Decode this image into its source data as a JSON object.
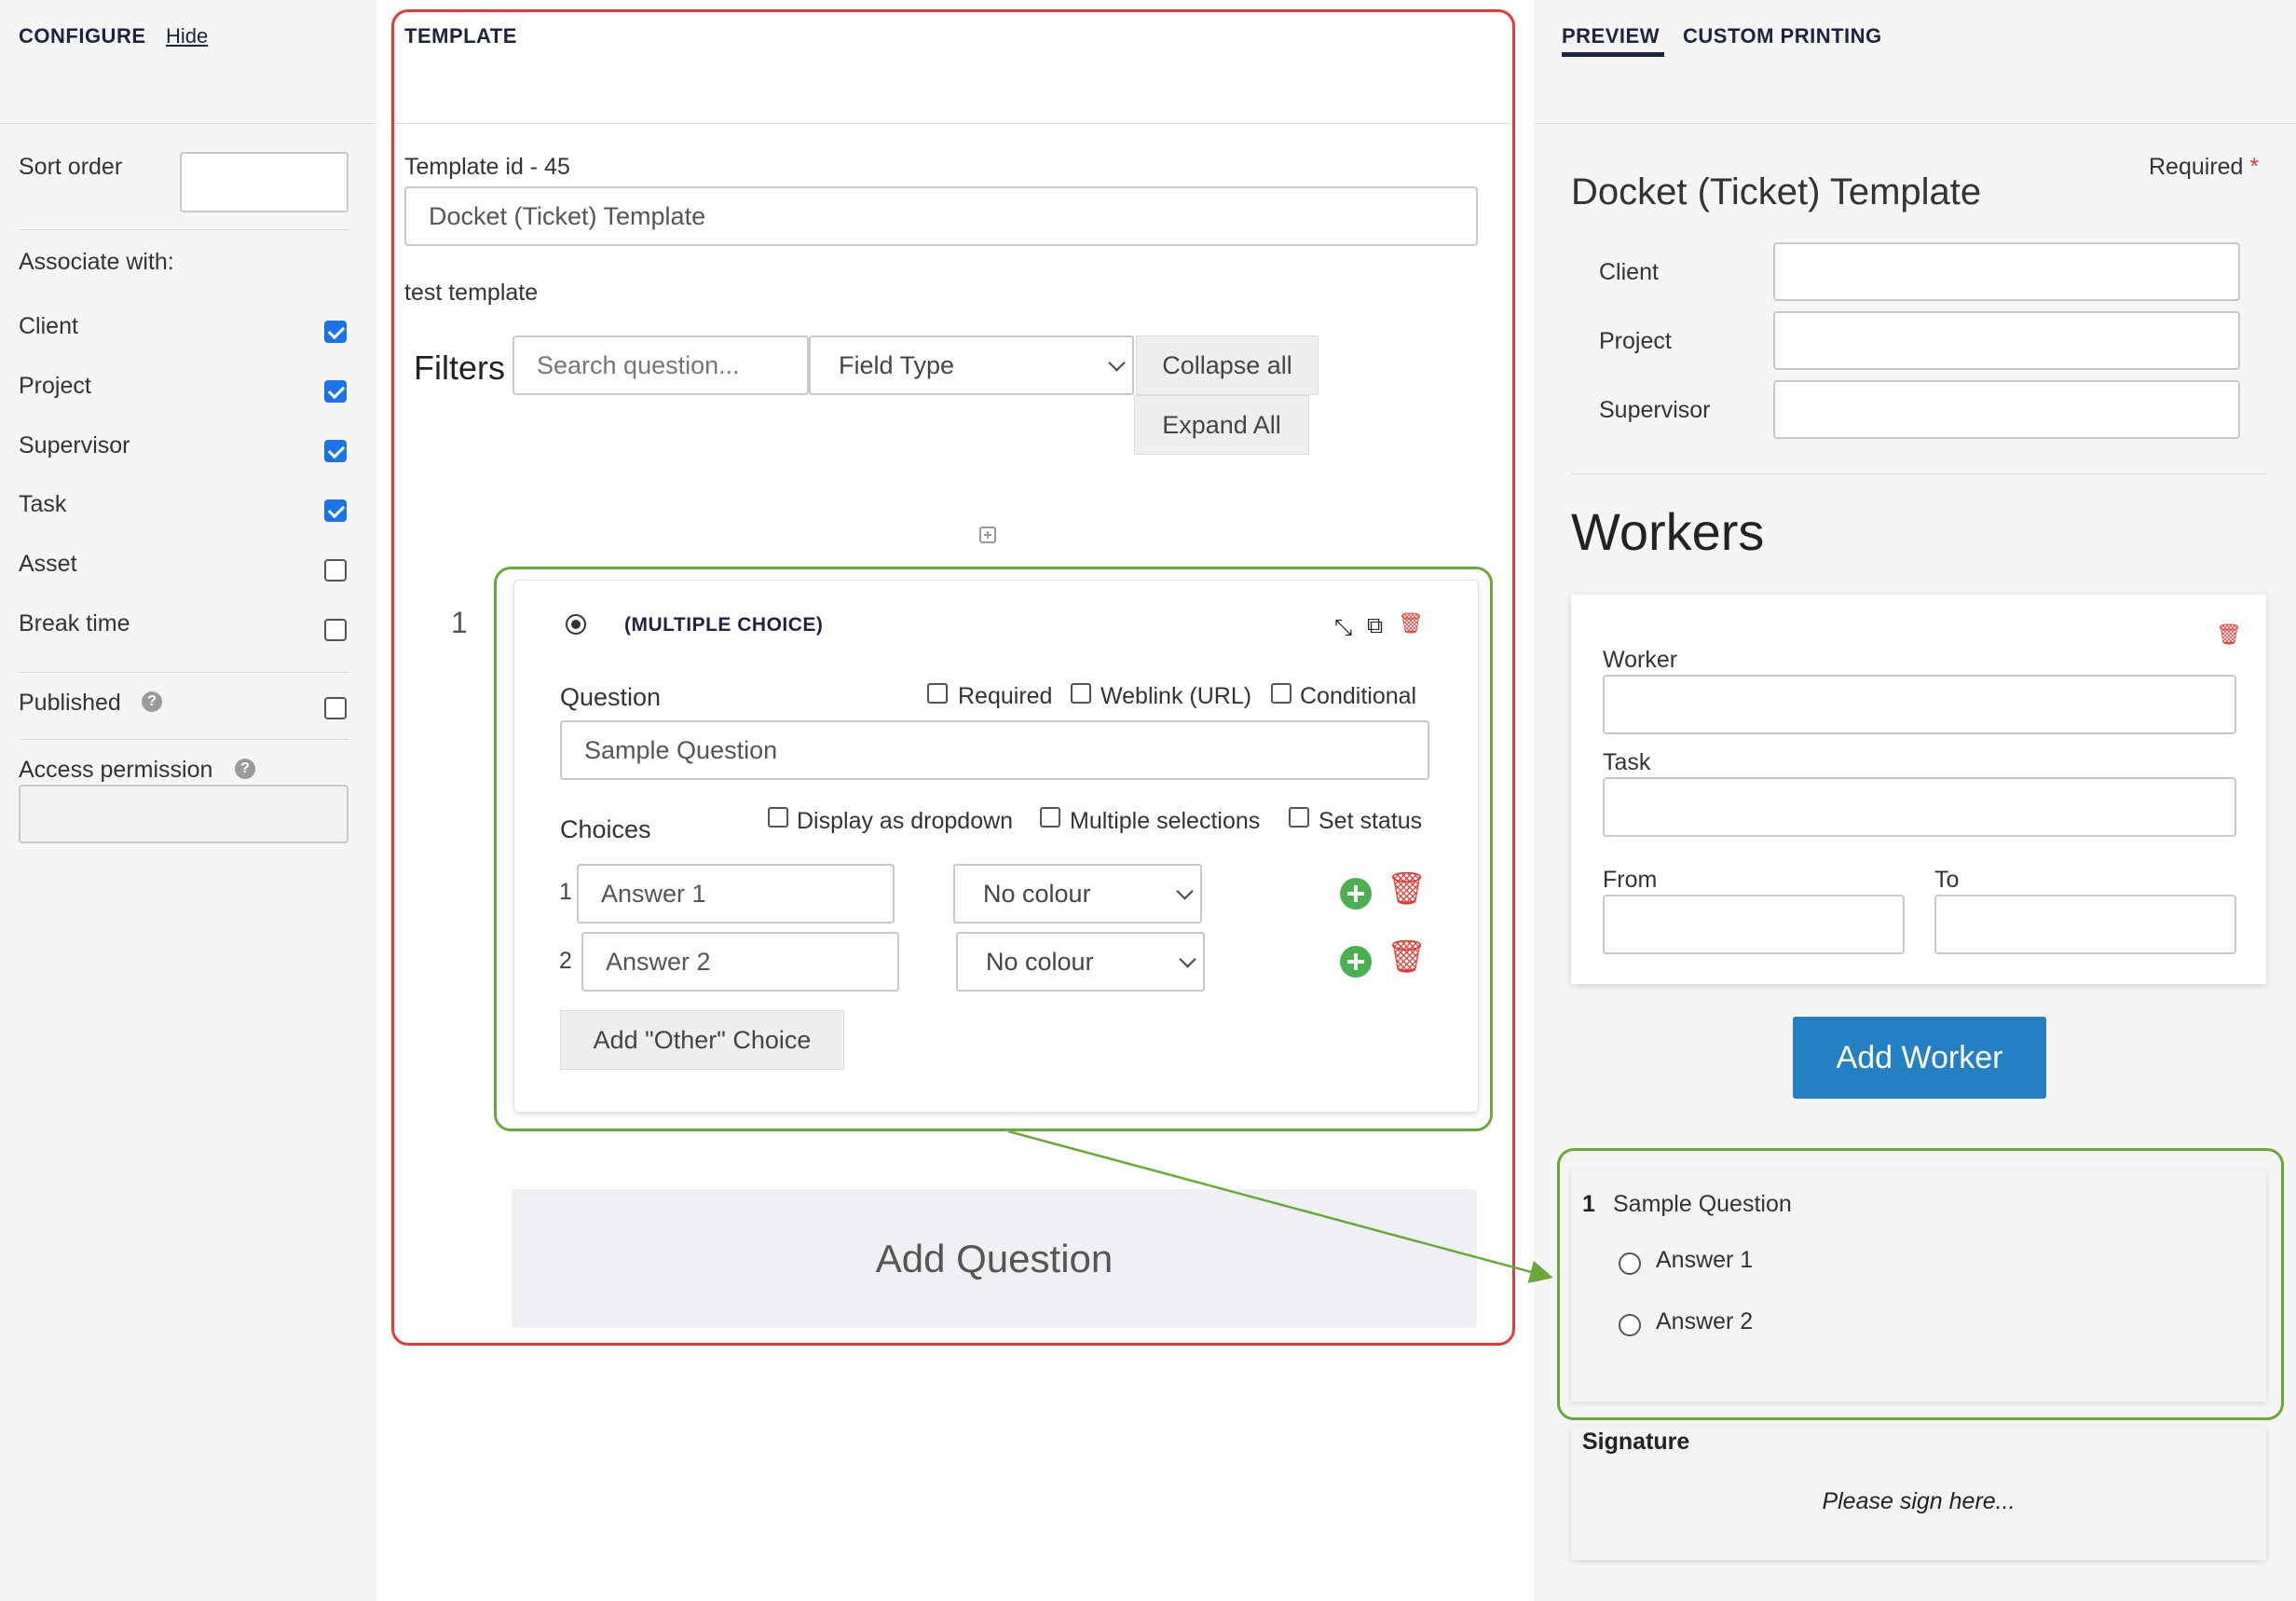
{
  "configure": {
    "title": "CONFIGURE",
    "hide_link": "Hide",
    "sort_order_label": "Sort order",
    "sort_order_value": "",
    "associate_label": "Associate with:",
    "associations": [
      {
        "label": "Client",
        "checked": true
      },
      {
        "label": "Project",
        "checked": true
      },
      {
        "label": "Supervisor",
        "checked": true
      },
      {
        "label": "Task",
        "checked": true
      },
      {
        "label": "Asset",
        "checked": false
      },
      {
        "label": "Break time",
        "checked": false
      }
    ],
    "published_label": "Published",
    "published_checked": false,
    "access_permission_label": "Access permission",
    "access_permission_value": ""
  },
  "template": {
    "title": "TEMPLATE",
    "id_label": "Template id - 45",
    "name_value": "Docket (Ticket) Template",
    "description": "test template",
    "filters_label": "Filters",
    "search_placeholder": "Search question...",
    "field_type_value": "Field Type",
    "collapse_all": "Collapse all",
    "expand_all": "Expand All",
    "question_number": "1",
    "question_type": "(MULTIPLE CHOICE)",
    "question_label": "Question",
    "required_label": "Required",
    "weblink_label": "Weblink (URL)",
    "conditional_label": "Conditional",
    "question_value": "Sample Question",
    "choices_label": "Choices",
    "display_dropdown_label": "Display as dropdown",
    "multiple_selections_label": "Multiple selections",
    "set_status_label": "Set status",
    "choices": [
      {
        "index": "1",
        "value": "Answer 1",
        "colour": "No colour"
      },
      {
        "index": "2",
        "value": "Answer 2",
        "colour": "No colour"
      }
    ],
    "add_other_choice": "Add \"Other\" Choice",
    "add_question": "Add Question"
  },
  "preview": {
    "tab_preview": "PREVIEW",
    "tab_custom_printing": "CUSTOM PRINTING",
    "required_label": "Required",
    "required_mark": "*",
    "template_title": "Docket (Ticket) Template",
    "fields": [
      "Client",
      "Project",
      "Supervisor"
    ],
    "workers_heading": "Workers",
    "worker_label": "Worker",
    "task_label": "Task",
    "from_label": "From",
    "to_label": "To",
    "add_worker": "Add Worker",
    "question_number": "1",
    "question_text": "Sample Question",
    "answers": [
      "Answer 1",
      "Answer 2"
    ],
    "signature_label": "Signature",
    "signature_placeholder": "Please sign here..."
  },
  "colors": {
    "accent_blue": "#2580c3",
    "annotation_red": "#e53935",
    "annotation_green": "#6aa83a",
    "add_green": "#4caf50",
    "delete_red": "#e53935"
  }
}
